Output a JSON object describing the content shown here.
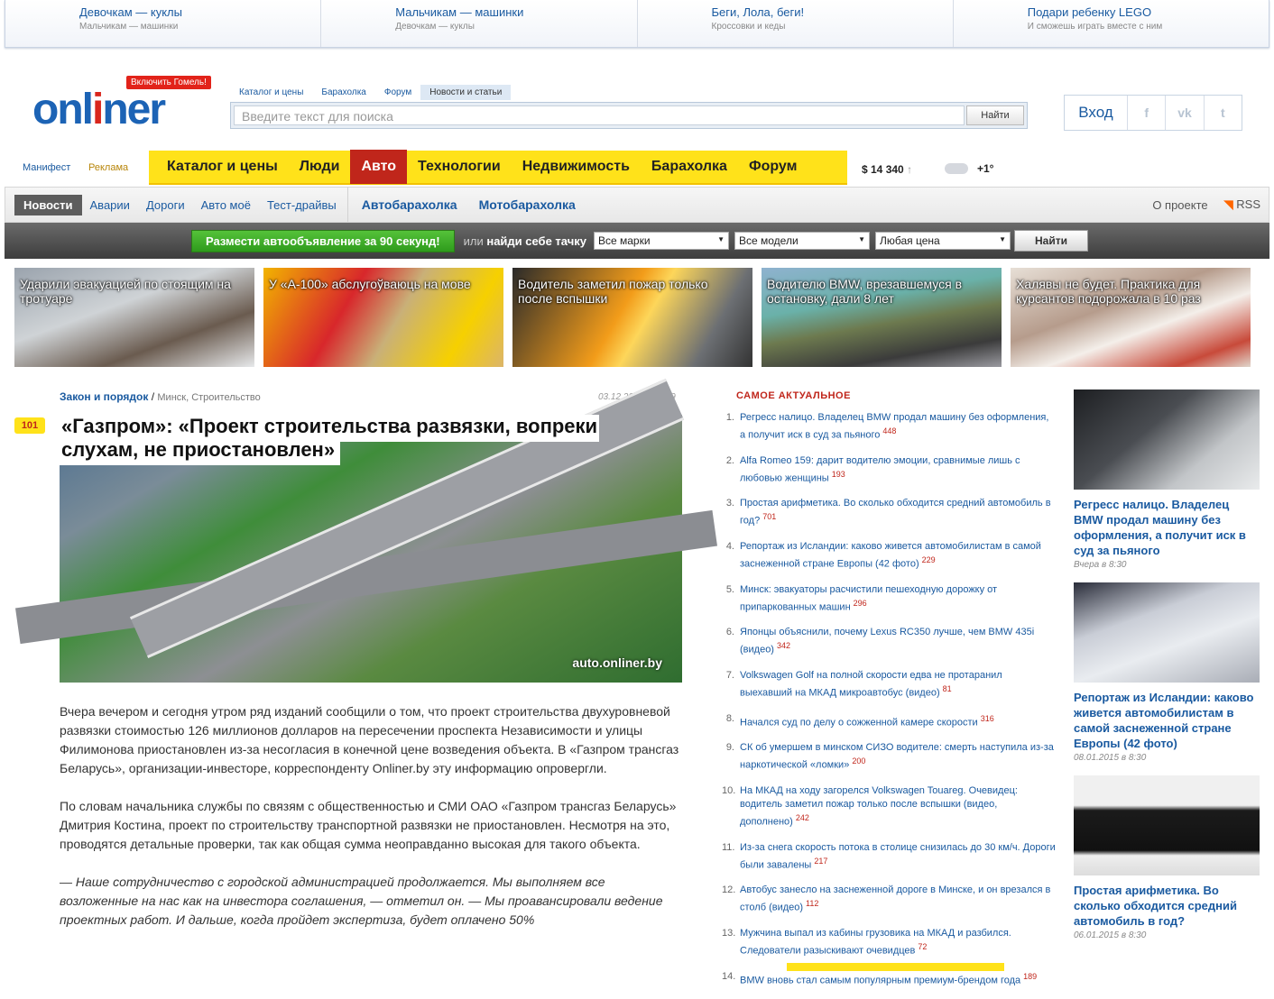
{
  "promo": [
    {
      "title": "Девочкам — куклы",
      "sub": "Мальчикам — машинки"
    },
    {
      "title": "Мальчикам — машинки",
      "sub": "Девочкам — куклы"
    },
    {
      "title": "Беги, Лола, беги!",
      "sub": "Кроссовки и кеды"
    },
    {
      "title": "Подари ребенку LEGO",
      "sub": "И сможешь играть вместе с ним"
    }
  ],
  "logo": {
    "text_a": "onl",
    "text_i": "i",
    "text_b": "ner",
    "badge": "Включить Гомель!"
  },
  "search": {
    "tabs": [
      "Каталог и цены",
      "Барахолка",
      "Форум",
      "Новости и статьи"
    ],
    "placeholder": "Введите текст для поиска",
    "button": "Найти"
  },
  "login": {
    "label": "Вход",
    "social": [
      "f",
      "vk",
      "t"
    ]
  },
  "mini_links": {
    "manifest": "Манифест",
    "ads": "Реклама"
  },
  "main_nav": [
    "Каталог и цены",
    "Люди",
    "Авто",
    "Технологии",
    "Недвижимость",
    "Барахолка",
    "Форум"
  ],
  "main_nav_active": "Авто",
  "currency": {
    "value": "$ 14 340",
    "arrow": "↑"
  },
  "weather": {
    "temp": "+1°",
    "icon": "cloud-icon"
  },
  "subnav": {
    "current": "Новости",
    "items": [
      "Аварии",
      "Дороги",
      "Авто моё",
      "Тест-драйвы"
    ],
    "big": [
      "Автобарахолка",
      "Мотобарахолка"
    ],
    "about": "О проекте",
    "rss": "RSS"
  },
  "autobar": {
    "cta": "Размести автообъявление за 90 секунд!",
    "or": "или",
    "or_bold": "найди себе тачку",
    "selects": [
      "Все марки",
      "Все модели",
      "Любая цена"
    ],
    "button": "Найти"
  },
  "tiles": [
    "Ударили эвакуацией по стоящим на тротуаре",
    "У «А-100» абслугоўваюць на мове",
    "Водитель заметил пожар только после вспышки",
    "Водителю BMW, врезавшемуся в остановку, дали 8 лет",
    "Халявы не будет. Практика для курсантов подорожала в 10 раз"
  ],
  "article": {
    "rubric": "Закон и порядок",
    "tags": "Минск, Строительство",
    "date": "03.12.2014 в 16:19",
    "comments": "101",
    "title_1": "«Газпром»: «Проект строительства развязки, вопреки",
    "title_2": "слухам, не приостановлен»",
    "watermark": "auto.onliner.by",
    "p1": "Вчера вечером и сегодня утром ряд изданий сообщили о том, что проект строительства двухуровневой развязки стоимостью 126 миллионов долларов на пересечении проспекта Независимости и улицы Филимонова приостановлен из-за несогласия в конечной цене возведения объекта. В «Газпром трансгаз Беларусь», организации-инвесторе, корреспонденту Onliner.by эту информацию опровергли.",
    "p2": "По словам начальника службы по связям с общественностью и СМИ ОАО «Газпром трансгаз Беларусь» Дмитрия Костина, проект по строительству транспортной развязки не приостановлен. Несмотря на это, проводятся детальные проверки, так как общая сумма неоправданно высокая для такого объекта.",
    "p3": "— Наше сотрудничество с городской администрацией продолжается. Мы выполняем все возложенные на нас как на инвестора соглашения, — отметил он. — Мы проавансировали ведение проектных работ. И дальше, когда пройдет экспертиза, будет оплачено 50%"
  },
  "top": {
    "heading": "САМОЕ АКТУАЛЬНОЕ",
    "items": [
      {
        "n": "1.",
        "t": "Регресс налицо. Владелец BMW продал машину без оформления, а получит иск в суд за пьяного",
        "c": "448"
      },
      {
        "n": "2.",
        "t": "Alfa Romeo 159: дарит водителю эмоции, сравнимые лишь с любовью женщины",
        "c": "193"
      },
      {
        "n": "3.",
        "t": "Простая арифметика. Во сколько обходится средний автомобиль в год?",
        "c": "701"
      },
      {
        "n": "4.",
        "t": "Репортаж из Исландии: каково живется автомобилистам в самой заснеженной стране Европы (42 фото)",
        "c": "229"
      },
      {
        "n": "5.",
        "t": "Минск: эвакуаторы расчистили пешеходную дорожку от припаркованных машин",
        "c": "296"
      },
      {
        "n": "6.",
        "t": "Японцы объяснили, почему Lexus RC350 лучше, чем BMW 435i (видео)",
        "c": "342"
      },
      {
        "n": "7.",
        "t": "Volkswagen Golf на полной скорости едва не протаранил выехавший на МКАД микроавтобус (видео)",
        "c": "81"
      },
      {
        "n": "8.",
        "t": "Начался суд по делу о сожженной камере скорости",
        "c": "316"
      },
      {
        "n": "9.",
        "t": "СК об умершем в минском СИЗО водителе: смерть наступила из-за наркотической «ломки»",
        "c": "200"
      },
      {
        "n": "10.",
        "t": "На МКАД на ходу загорелся Volkswagen Touareg. Очевидец: водитель заметил пожар только после вспышки (видео, дополнено)",
        "c": "242"
      },
      {
        "n": "11.",
        "t": "Из-за снега скорость потока в столице снизилась до 30 км/ч. Дороги были завалены",
        "c": "217"
      },
      {
        "n": "12.",
        "t": "Автобус занесло на заснеженной дороге в Минске, и он врезался в столб (видео)",
        "c": "112"
      },
      {
        "n": "13.",
        "t": "Мужчина выпал из кабины грузовика на МКАД и разбился. Следователи разыскивают очевидцев",
        "c": "72"
      },
      {
        "n": "14.",
        "t": "BMW вновь стал самым популярным премиум-брендом года",
        "c": "189"
      }
    ]
  },
  "right": [
    {
      "title": "Регресс налицо. Владелец BMW продал машину без оформления, а получит иск в суд за пьяного",
      "date": "Вчера в 8:30"
    },
    {
      "title": "Репортаж из Исландии: каково живется автомобилистам в самой заснеженной стране Европы (42 фото)",
      "date": "08.01.2015 в 8:30"
    },
    {
      "title": "Простая арифметика. Во сколько обходится средний автомобиль в год?",
      "date": "06.01.2015 в 8:30"
    }
  ]
}
